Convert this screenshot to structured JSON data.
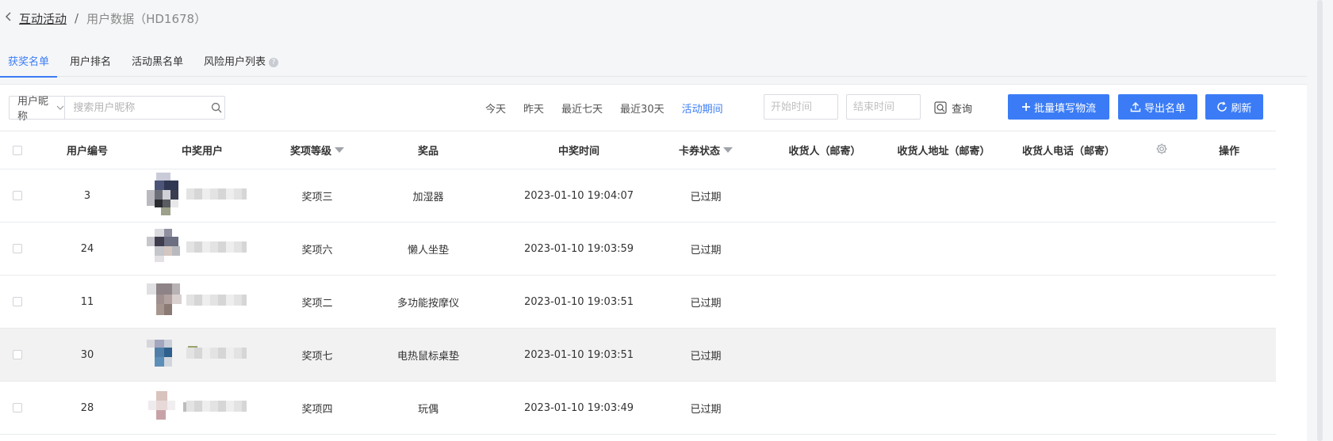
{
  "breadcrumb": {
    "back_icon": "chevron-left-icon",
    "parent": "互动活动",
    "separator": "/",
    "current": "用户数据（HD1678）"
  },
  "tabs": [
    {
      "label": "获奖名单",
      "active": true
    },
    {
      "label": "用户排名"
    },
    {
      "label": "活动黑名单"
    },
    {
      "label": "风险用户列表",
      "help_icon": "question-circle-icon"
    }
  ],
  "filters": {
    "search_field": "用户昵称",
    "search_placeholder": "搜索用户昵称",
    "date_links": [
      "今天",
      "昨天",
      "最近七天",
      "最近30天",
      "活动期间"
    ],
    "active_date_link": "活动期间",
    "start_placeholder": "开始时间",
    "end_placeholder": "结束时间",
    "query_label": "查询"
  },
  "buttons": {
    "batch": "批量填写物流",
    "export": "导出名单",
    "refresh": "刷新"
  },
  "table": {
    "headers": {
      "id": "用户编号",
      "user": "中奖用户",
      "level": "奖项等级",
      "prize": "奖品",
      "time": "中奖时间",
      "status": "卡券状态",
      "receiver": "收货人（邮寄）",
      "address": "收货人地址（邮寄）",
      "phone": "收货人电话（邮寄）",
      "op": "操作"
    },
    "rows": [
      {
        "id": "3",
        "level": "奖项三",
        "prize": "加湿器",
        "time": "2023-01-10 19:04:07",
        "status": "已过期"
      },
      {
        "id": "24",
        "level": "奖项六",
        "prize": "懒人坐垫",
        "time": "2023-01-10 19:03:59",
        "status": "已过期"
      },
      {
        "id": "11",
        "level": "奖项二",
        "prize": "多功能按摩仪",
        "time": "2023-01-10 19:03:51",
        "status": "已过期"
      },
      {
        "id": "30",
        "level": "奖项七",
        "prize": "电热鼠标桌垫",
        "time": "2023-01-10 19:03:51",
        "status": "已过期"
      },
      {
        "id": "28",
        "level": "奖项四",
        "prize": "玩偶",
        "time": "2023-01-10 19:03:49",
        "status": "已过期"
      }
    ]
  },
  "colors": {
    "accent": "#3b7cf6",
    "hover_row": "#f2f2f2"
  }
}
